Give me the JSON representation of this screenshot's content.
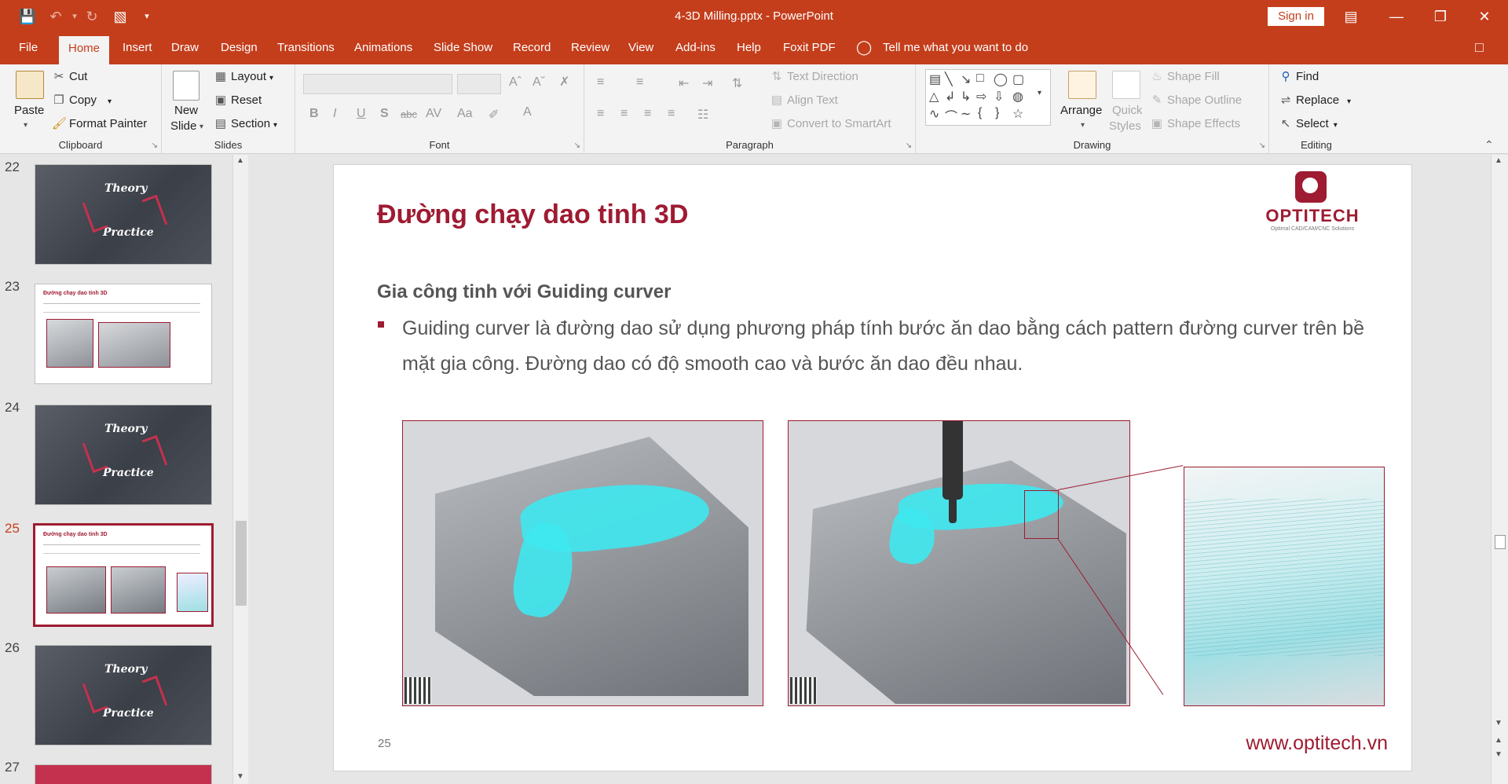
{
  "window": {
    "title": "4-3D Milling.pptx  -  PowerPoint",
    "sign_in": "Sign in"
  },
  "tabs": [
    "File",
    "Home",
    "Insert",
    "Draw",
    "Design",
    "Transitions",
    "Animations",
    "Slide Show",
    "Record",
    "Review",
    "View",
    "Add-ins",
    "Help",
    "Foxit PDF"
  ],
  "tell_me": "Tell me what you want to do",
  "ribbon": {
    "clipboard": {
      "paste": "Paste",
      "cut": "Cut",
      "copy": "Copy",
      "format_painter": "Format Painter",
      "label": "Clipboard"
    },
    "slides": {
      "new_slide_1": "New",
      "new_slide_2": "Slide",
      "layout": "Layout",
      "reset": "Reset",
      "section": "Section",
      "label": "Slides"
    },
    "font": {
      "label": "Font",
      "bold": "B",
      "italic": "I",
      "underline": "U",
      "shadow": "S",
      "strike": "abc",
      "aa": "Aa",
      "font_color": "A"
    },
    "paragraph": {
      "label": "Paragraph",
      "text_direction": "Text Direction",
      "align_text": "Align Text",
      "convert_smartart": "Convert to SmartArt"
    },
    "drawing": {
      "label": "Drawing",
      "arrange": "Arrange",
      "quick_styles_1": "Quick",
      "quick_styles_2": "Styles",
      "shape_fill": "Shape Fill",
      "shape_outline": "Shape Outline",
      "shape_effects": "Shape Effects"
    },
    "editing": {
      "label": "Editing",
      "find": "Find",
      "replace": "Replace",
      "select": "Select"
    }
  },
  "thumbnails": [
    {
      "num": "22",
      "kind": "dark",
      "t1": "Theory",
      "t2": "Practice"
    },
    {
      "num": "23",
      "kind": "light",
      "title": "Đường chạy dao tinh 3D"
    },
    {
      "num": "24",
      "kind": "dark",
      "t1": "Theory",
      "t2": "Practice"
    },
    {
      "num": "25",
      "kind": "light",
      "title": "Đường chạy dao tinh 3D"
    },
    {
      "num": "26",
      "kind": "dark",
      "t1": "Theory",
      "t2": "Practice"
    },
    {
      "num": "27",
      "kind": "red"
    }
  ],
  "slide": {
    "title": "Đường chạy dao tinh 3D",
    "logo_text": "OPTITECH",
    "logo_sub": "Optimal CAD/CAM/CNC Solutions",
    "subhead": "Gia công tinh với Guiding curver",
    "bullet": "Guiding curver là đường dao sử dụng phương pháp tính bước ăn dao bằng cách pattern đường curver trên bề mặt gia công. Đường dao có độ smooth cao và bước ăn dao đều nhau.",
    "number": "25",
    "website": "www.optitech.vn"
  },
  "colors": {
    "accent": "#c43e1c",
    "brand": "#9e1b32"
  }
}
